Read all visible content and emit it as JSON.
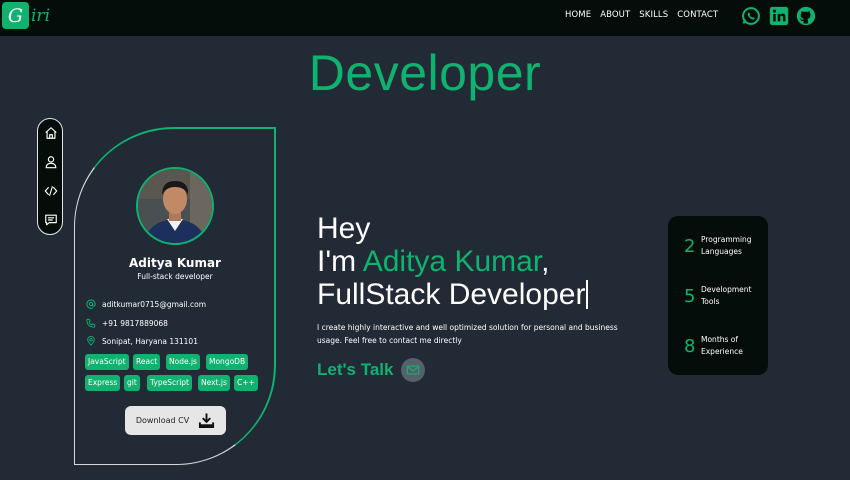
{
  "navbar": {
    "logo_letter": "G",
    "logo_rest": "iri",
    "links": [
      "HOME",
      "ABOUT",
      "SKILLS",
      "CONTACT"
    ],
    "social_icons": [
      "whatsapp-icon",
      "linkedin-icon",
      "github-icon"
    ]
  },
  "hero": {
    "title": "Developer"
  },
  "side_nav": {
    "icons": [
      "home-icon",
      "user-icon",
      "code-icon",
      "message-icon"
    ]
  },
  "profile": {
    "name": "Aditya Kumar",
    "role": "Full-stack developer",
    "email": "aditkumar0715@gmail.com",
    "phone": "+91 9817889068",
    "location": "Sonipat, Haryana 131101",
    "skills_row1": [
      "JavaScript",
      "React",
      "Node.js",
      "MongoDB"
    ],
    "skills_row2": [
      "Express",
      "git",
      "TypeScript",
      "Next.js",
      "C++"
    ],
    "download_label": "Download CV"
  },
  "intro": {
    "line1": "Hey",
    "line2_prefix": "I'm ",
    "line2_name": "Aditya Kumar",
    "line2_suffix": ",",
    "line3": "FullStack Developer",
    "description": "I create highly interactive and well optimized solution for personal and business usage. Feel free to contact me directly",
    "cta_label": "Let's Talk"
  },
  "stats": [
    {
      "number": "2",
      "label_line1": "Programming",
      "label_line2": "Languages"
    },
    {
      "number": "5",
      "label_line1": "Development",
      "label_line2": "Tools"
    },
    {
      "number": "8",
      "label_line1": "Months of",
      "label_line2": "Experience"
    }
  ],
  "colors": {
    "accent": "#10b26f",
    "background": "#222a36",
    "navbar": "#040d09"
  }
}
